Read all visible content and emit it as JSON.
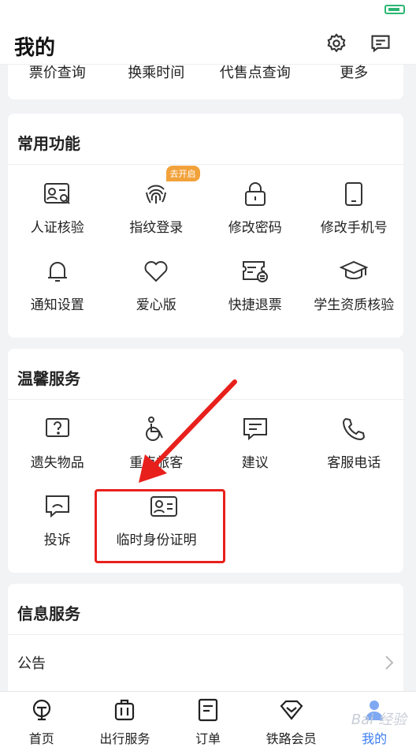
{
  "header": {
    "title": "我的"
  },
  "top_shortcuts": [
    "票价查询",
    "换乘时间",
    "代售点查询",
    "更多"
  ],
  "common": {
    "title": "常用功能",
    "items": [
      {
        "label": "人证核验",
        "icon": "id-face-icon"
      },
      {
        "label": "指纹登录",
        "icon": "fingerprint-icon",
        "badge": "去开启"
      },
      {
        "label": "修改密码",
        "icon": "lock-icon"
      },
      {
        "label": "修改手机号",
        "icon": "phone-icon"
      },
      {
        "label": "通知设置",
        "icon": "bell-icon"
      },
      {
        "label": "爱心版",
        "icon": "heart-icon"
      },
      {
        "label": "快捷退票",
        "icon": "refund-ticket-icon"
      },
      {
        "label": "学生资质核验",
        "icon": "graduation-cap-icon"
      }
    ]
  },
  "warm": {
    "title": "温馨服务",
    "items": [
      {
        "label": "遗失物品",
        "icon": "question-box-icon"
      },
      {
        "label": "重点旅客",
        "icon": "wheelchair-icon"
      },
      {
        "label": "建议",
        "icon": "comment-icon"
      },
      {
        "label": "客服电话",
        "icon": "phone-call-icon"
      },
      {
        "label": "投诉",
        "icon": "complaint-icon"
      },
      {
        "label": "临时身份证明",
        "icon": "id-card-icon"
      }
    ]
  },
  "info": {
    "title": "信息服务",
    "rows": [
      {
        "label": "公告"
      }
    ]
  },
  "tabs": [
    {
      "label": "首页",
      "icon": "railway-logo-icon"
    },
    {
      "label": "出行服务",
      "icon": "luggage-icon"
    },
    {
      "label": "订单",
      "icon": "order-icon"
    },
    {
      "label": "铁路会员",
      "icon": "diamond-icon"
    },
    {
      "label": "我的",
      "icon": "user-icon",
      "active": true
    }
  ],
  "colors": {
    "accent": "#3b7cf0",
    "highlight": "#e8201c",
    "badge": "#f2a23a"
  },
  "watermark": "Bai 经验"
}
